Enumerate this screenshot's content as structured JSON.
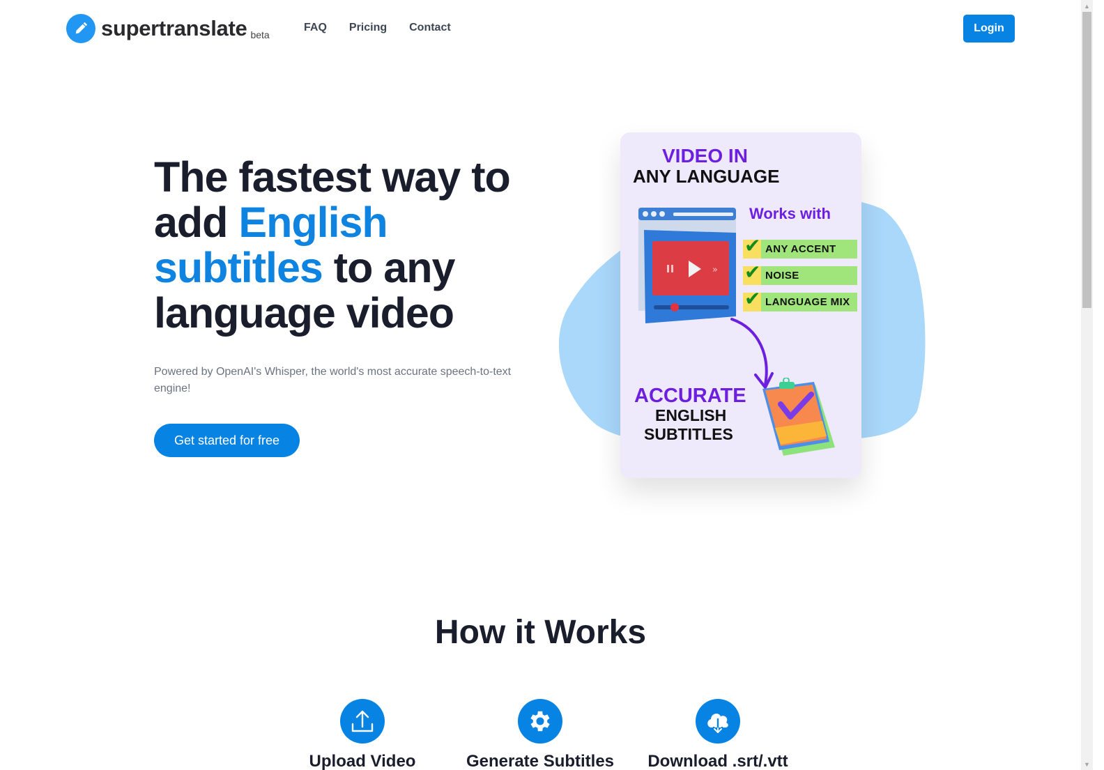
{
  "header": {
    "brand": "supertranslate",
    "badge": "beta",
    "nav": [
      {
        "label": "FAQ"
      },
      {
        "label": "Pricing"
      },
      {
        "label": "Contact"
      }
    ],
    "login_label": "Login"
  },
  "hero": {
    "title_part1": "The fastest way to add ",
    "title_highlight": "English subtitles",
    "title_part2": " to any language video",
    "subtitle": "Powered by OpenAI's Whisper, the world's most accurate speech-to-text engine!",
    "cta_label": "Get started for free"
  },
  "illustration": {
    "heading_line1": "VIDEO IN",
    "heading_line2": "ANY LANGUAGE",
    "works_with": "Works with",
    "features": [
      "ANY ACCENT",
      "NOISE",
      "LANGUAGE MIX"
    ],
    "result_line1": "ACCURATE",
    "result_line2": "ENGLISH",
    "result_line3": "SUBTITLES",
    "colors": {
      "purple": "#6d1fe0",
      "green": "#a0e57c",
      "yellow": "#f8df60",
      "blob": "#a9d8fb"
    }
  },
  "how_it_works": {
    "title": "How it Works",
    "steps": [
      {
        "icon": "upload-icon",
        "label": "Upload Video"
      },
      {
        "icon": "gear-icon",
        "label": "Generate Subtitles"
      },
      {
        "icon": "cloud-download-icon",
        "label": "Download .srt/.vtt"
      }
    ]
  },
  "theme": {
    "accent": "#0783e3",
    "logo": "#2196f3",
    "text": "#1a1d2b"
  }
}
